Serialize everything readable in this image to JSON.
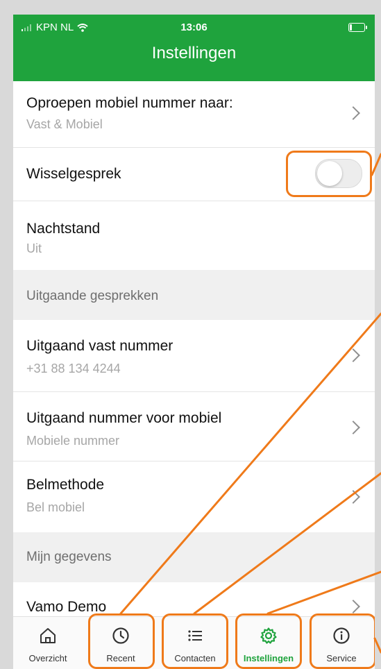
{
  "status_bar": {
    "carrier": "KPN NL",
    "time": "13:06"
  },
  "header": {
    "title": "Instellingen"
  },
  "settings": {
    "forwarding": {
      "title": "Oproepen mobiel nummer naar:",
      "value": "Vast & Mobiel"
    },
    "call_waiting": {
      "title": "Wisselgesprek",
      "enabled": false
    },
    "night_mode": {
      "title": "Nachtstand",
      "value": "Uit"
    },
    "section_outgoing": "Uitgaande gesprekken",
    "outgoing_fixed": {
      "title": "Uitgaand vast nummer",
      "value": "+31 88 134 4244"
    },
    "outgoing_mobile": {
      "title": "Uitgaand nummer voor mobiel",
      "value": "Mobiele nummer"
    },
    "call_method": {
      "title": "Belmethode",
      "value": "Bel mobiel"
    },
    "section_my_data": "Mijn gegevens",
    "profile": {
      "title": "Vamo Demo"
    }
  },
  "tabbar": {
    "items": [
      {
        "label": "Overzicht",
        "icon": "home-icon"
      },
      {
        "label": "Recent",
        "icon": "clock-icon"
      },
      {
        "label": "Contacten",
        "icon": "list-icon"
      },
      {
        "label": "Instellingen",
        "icon": "gear-icon",
        "active": true
      },
      {
        "label": "Service",
        "icon": "info-icon"
      }
    ]
  },
  "colors": {
    "brand": "#1fa33d",
    "annotation": "#ef7a1a"
  }
}
